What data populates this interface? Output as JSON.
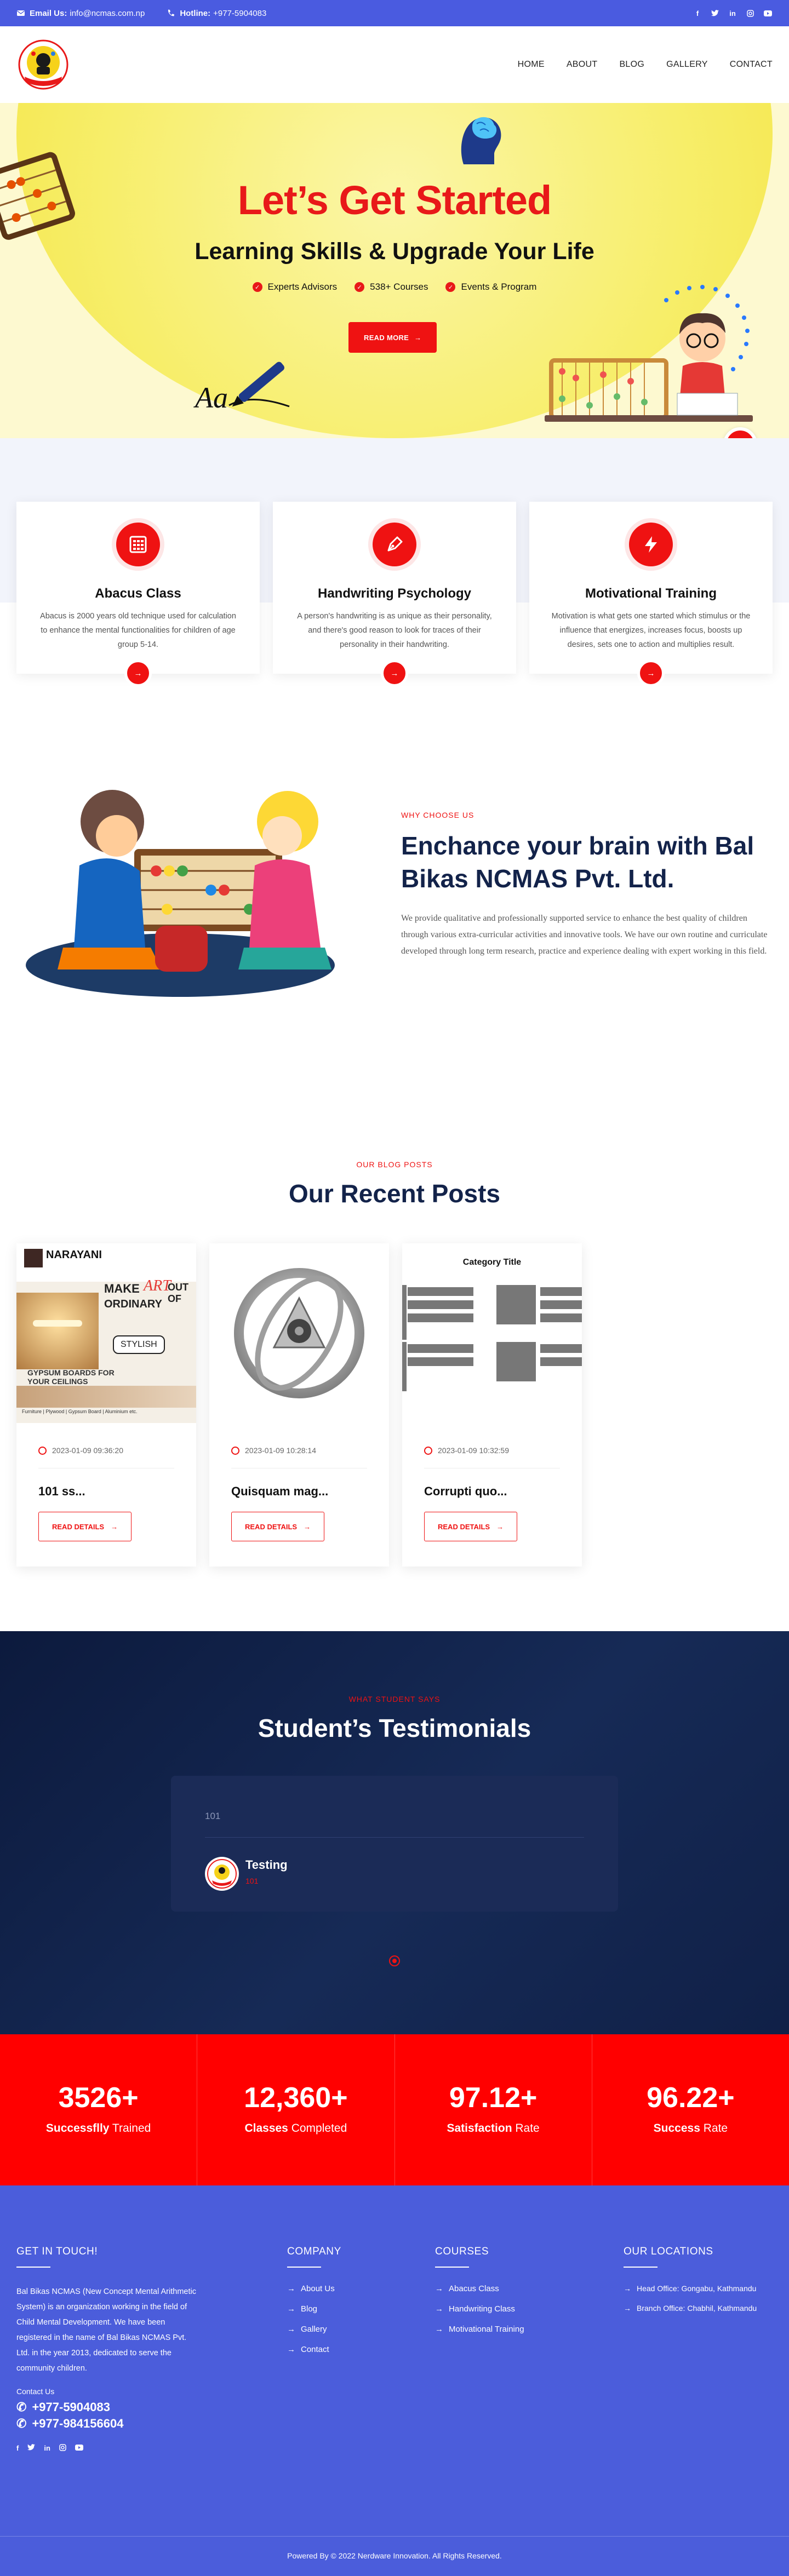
{
  "topbar": {
    "email_label": "Email Us:",
    "email": "info@ncmas.com.np",
    "hotline_label": "Hotline:",
    "hotline": "+977-5904083",
    "socials": [
      "facebook-icon",
      "twitter-icon",
      "linkedin-icon",
      "instagram-icon",
      "youtube-icon"
    ]
  },
  "nav": {
    "items": [
      "HOME",
      "ABOUT",
      "BLOG",
      "GALLERY",
      "CONTACT"
    ]
  },
  "hero": {
    "title": "Let’s Get Started",
    "subtitle": "Learning Skills & Upgrade Your Life",
    "features": [
      "Experts Advisors",
      "538+ Courses",
      "Events & Program"
    ],
    "cta": "READ MORE"
  },
  "services": [
    {
      "title": "Abacus Class",
      "text": "Abacus is 2000 years old technique used for calculation to enhance the mental functionalities for children of age group 5-14."
    },
    {
      "title": "Handwriting Psychology",
      "text": "A person's handwriting is as unique as their personality, and there's good reason to look for traces of their personality in their handwriting."
    },
    {
      "title": "Motivational Training",
      "text": "Motivation is what gets one started which stimulus or the influence that energizes, increases focus, boosts up desires, sets one to action and multiplies result."
    }
  ],
  "why": {
    "kicker": "WHY CHOOSE US",
    "title": "Enchance your brain with Bal Bikas NCMAS Pvt. Ltd.",
    "text": "We provide qualitative and professionally supported service to enhance the best quality of children through various extra-curricular activities and innovative tools. We have our own routine and curriculate developed through long term research, practice and experience dealing with expert working in this field."
  },
  "blog": {
    "kicker": "OUR BLOG POSTS",
    "title": "Our Recent Posts",
    "read_label": "READ DETAILS",
    "posts": [
      {
        "date": "2023-01-09 09:36:20",
        "title": "101 ss...",
        "thumb_brand": "NARAYANI",
        "thumb_line1": "MAKE",
        "thumb_art": "ART",
        "thumb_line2": "OUT OF",
        "thumb_line3": "ORDINARY",
        "thumb_tag": "STYLISH",
        "thumb_bottom": "GYPSUM BOARDS FOR YOUR CEILINGS",
        "thumb_footer": "Furniture | Plywood | Gypsum Board | Aluminium etc."
      },
      {
        "date": "2023-01-09 10:28:14",
        "title": "Quisquam mag..."
      },
      {
        "date": "2023-01-09 10:32:59",
        "title": "Corrupti quo...",
        "thumb_title": "Category Title"
      }
    ]
  },
  "testimonials": {
    "kicker": "WHAT STUDENT SAYS",
    "title": "Student’s Testimonials",
    "quote": "101",
    "name": "Testing",
    "role": "101"
  },
  "stats": [
    {
      "value": "3526+",
      "bold": "Successflly",
      "label": " Trained"
    },
    {
      "value": "12,360+",
      "bold": "Classes",
      "label": " Completed"
    },
    {
      "value": "97.12+",
      "bold": "Satisfaction",
      "label": " Rate"
    },
    {
      "value": "96.22+",
      "bold": "Success",
      "label": " Rate"
    }
  ],
  "footer": {
    "get_in_touch": "GET IN TOUCH!",
    "about": "Bal Bikas NCMAS (New Concept Mental Arithmetic System) is an organization working in the field of Child Mental Development. We have been registered in the name of Bal Bikas NCMAS Pvt. Ltd. in the year 2013, dedicated to serve the community children.",
    "contact_label": "Contact Us",
    "phones": [
      "+977-5904083",
      "+977-984156604"
    ],
    "company_title": "COMPANY",
    "company": [
      "About Us",
      "Blog",
      "Gallery",
      "Contact"
    ],
    "courses_title": "COURSES",
    "courses": [
      "Abacus Class",
      "Handwriting Class",
      "Motivational Training"
    ],
    "locations_title": "OUR LOCATIONS",
    "locations": [
      "Head Office: Gongabu, Kathmandu",
      "Branch Office: Chabhil, Kathmandu"
    ],
    "copyright": "Powered By © 2022 Nerdware Innovation. All Rights Reserved."
  },
  "colors": {
    "accent": "#ef1212",
    "brand": "#4a5be0",
    "navy": "#13234a",
    "hero_yellow": "#f3e33e"
  }
}
